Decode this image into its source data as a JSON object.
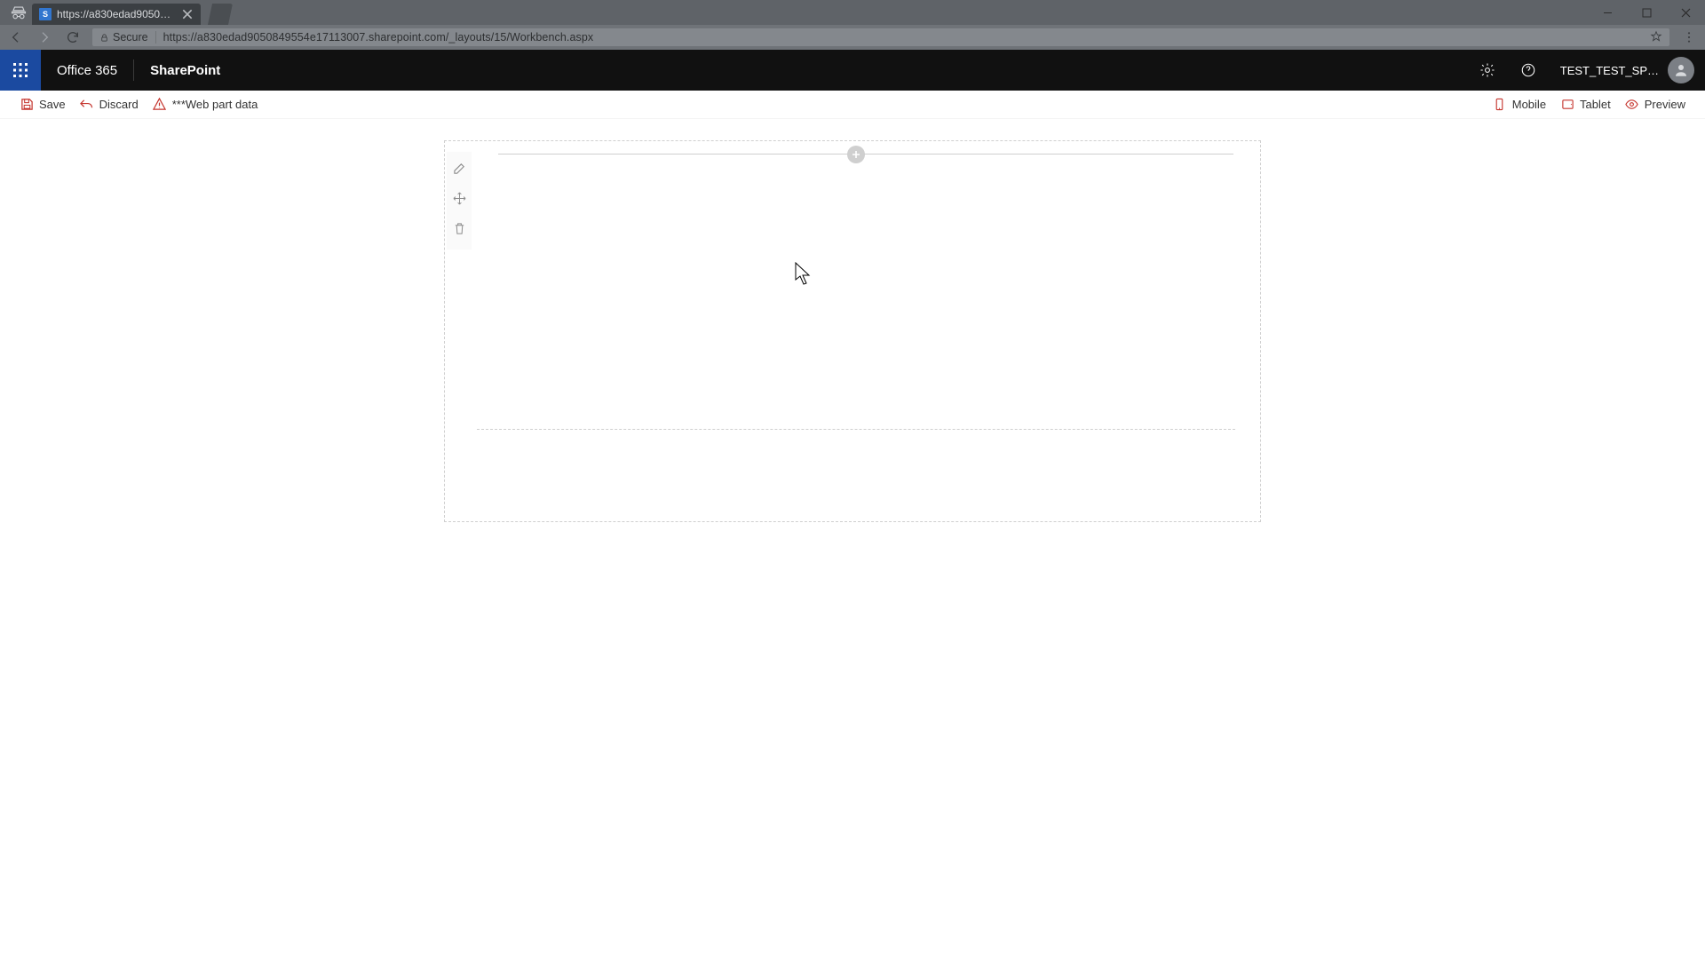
{
  "browser": {
    "tab_title": "https://a830edad905084…",
    "url": "https://a830edad9050849554e17113007.sharepoint.com/_layouts/15/Workbench.aspx",
    "secure_label": "Secure"
  },
  "suite": {
    "brand": "Office 365",
    "app": "SharePoint",
    "user": "TEST_TEST_SP…"
  },
  "commands": {
    "save": "Save",
    "discard": "Discard",
    "webpartdata": "***Web part data",
    "mobile": "Mobile",
    "tablet": "Tablet",
    "preview": "Preview"
  }
}
